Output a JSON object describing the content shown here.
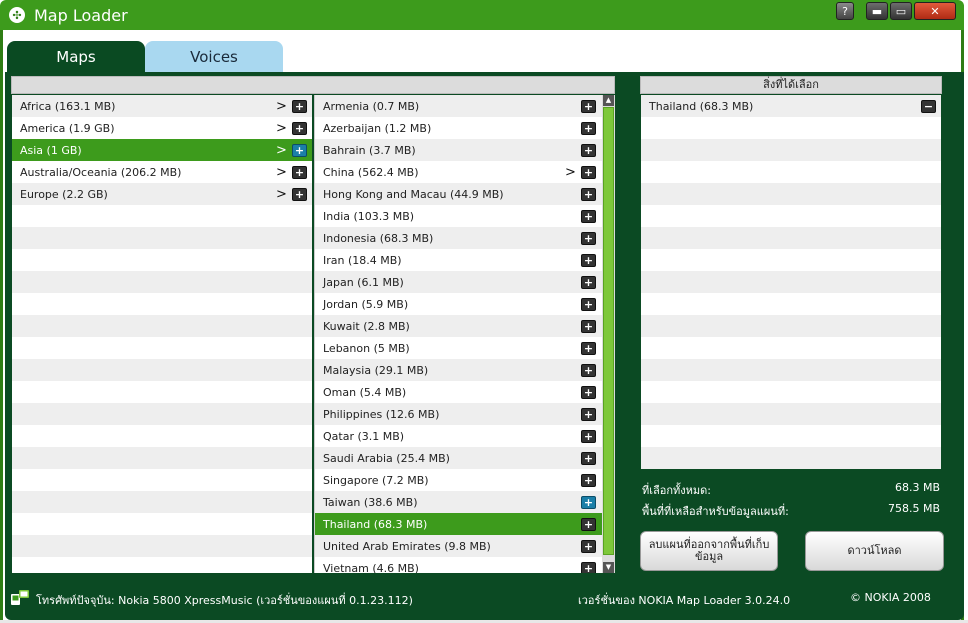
{
  "window": {
    "title": "Map Loader",
    "buttons": {
      "help": "?",
      "minimize": "▬",
      "maximize": "▭",
      "close": "✕"
    }
  },
  "tabs": [
    {
      "label": "Maps",
      "active": true
    },
    {
      "label": "Voices",
      "active": false
    }
  ],
  "regions": [
    {
      "label": "Africa (163.1 MB)",
      "selected": false
    },
    {
      "label": "America (1.9 GB)",
      "selected": false
    },
    {
      "label": "Asia (1 GB)",
      "selected": true
    },
    {
      "label": "Australia/Oceania (206.2 MB)",
      "selected": false
    },
    {
      "label": "Europe (2.2 GB)",
      "selected": false
    }
  ],
  "countries": [
    {
      "label": "Armenia (0.7 MB)",
      "submenu": false,
      "selected": false,
      "added": false
    },
    {
      "label": "Azerbaijan (1.2 MB)",
      "submenu": false,
      "selected": false,
      "added": false
    },
    {
      "label": "Bahrain (3.7 MB)",
      "submenu": false,
      "selected": false,
      "added": false
    },
    {
      "label": "China (562.4 MB)",
      "submenu": true,
      "selected": false,
      "added": false
    },
    {
      "label": "Hong Kong and Macau (44.9 MB)",
      "submenu": false,
      "selected": false,
      "added": false
    },
    {
      "label": "India (103.3 MB)",
      "submenu": false,
      "selected": false,
      "added": false
    },
    {
      "label": "Indonesia (68.3 MB)",
      "submenu": false,
      "selected": false,
      "added": false
    },
    {
      "label": "Iran (18.4 MB)",
      "submenu": false,
      "selected": false,
      "added": false
    },
    {
      "label": "Japan (6.1 MB)",
      "submenu": false,
      "selected": false,
      "added": false
    },
    {
      "label": "Jordan (5.9 MB)",
      "submenu": false,
      "selected": false,
      "added": false
    },
    {
      "label": "Kuwait (2.8 MB)",
      "submenu": false,
      "selected": false,
      "added": false
    },
    {
      "label": "Lebanon (5 MB)",
      "submenu": false,
      "selected": false,
      "added": false
    },
    {
      "label": "Malaysia (29.1 MB)",
      "submenu": false,
      "selected": false,
      "added": false
    },
    {
      "label": "Oman (5.4 MB)",
      "submenu": false,
      "selected": false,
      "added": false
    },
    {
      "label": "Philippines (12.6 MB)",
      "submenu": false,
      "selected": false,
      "added": false
    },
    {
      "label": "Qatar (3.1 MB)",
      "submenu": false,
      "selected": false,
      "added": false
    },
    {
      "label": "Saudi Arabia (25.4 MB)",
      "submenu": false,
      "selected": false,
      "added": false
    },
    {
      "label": "Singapore (7.2 MB)",
      "submenu": false,
      "selected": false,
      "added": false
    },
    {
      "label": "Taiwan (38.6 MB)",
      "submenu": false,
      "selected": false,
      "added": true
    },
    {
      "label": "Thailand (68.3 MB)",
      "submenu": false,
      "selected": true,
      "added": false
    },
    {
      "label": "United Arab Emirates (9.8 MB)",
      "submenu": false,
      "selected": false,
      "added": false
    },
    {
      "label": "Vietnam (4.6 MB)",
      "submenu": false,
      "selected": false,
      "added": false
    }
  ],
  "selection": {
    "header": "สิ่งที่ได้เลือก",
    "items": [
      {
        "label": "Thailand (68.3 MB)"
      }
    ],
    "total_label": "ที่เลือกทั้งหมด:",
    "total_value": "68.3 MB",
    "free_label": "พื้นที่ที่เหลือสำหรับข้อมูลแผนที่:",
    "free_value": "758.5 MB"
  },
  "buttons": {
    "remove": "ลบแผนที่ออกจากพื้นที่เก็บข้อมูล",
    "download": "ดาวน์โหลด"
  },
  "footer": {
    "phone": "โทรศัพท์ปัจจุบัน: Nokia 5800 XpressMusic (เวอร์ชั่นของแผนที่ 0.1.23.112)",
    "version": "เวอร์ชั่นของ NOKIA Map Loader 3.0.24.0",
    "copyright": "© NOKIA 2008"
  },
  "colors": {
    "accent": "#3d9b1c",
    "panel": "#0b4a23",
    "voices_tab": "#a9d8f0"
  }
}
